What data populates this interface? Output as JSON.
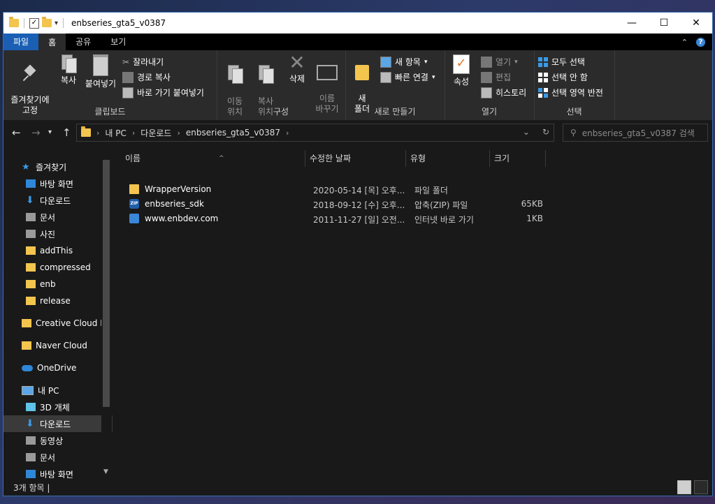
{
  "window": {
    "title": "enbseries_gta5_v0387",
    "controls": {
      "minimize": "—",
      "maximize": "☐",
      "close": "✕"
    }
  },
  "tabs": [
    {
      "label": "파일"
    },
    {
      "label": "홈"
    },
    {
      "label": "공유"
    },
    {
      "label": "보기"
    }
  ],
  "ribbon": {
    "clipboard": {
      "label": "클립보드",
      "pin": "즐겨찾기에\n고정",
      "copy": "복사",
      "paste": "붙여넣기",
      "cut": "잘라내기",
      "copy_path": "경로 복사",
      "paste_shortcut": "바로 가기 붙여넣기"
    },
    "organize": {
      "label": "구성",
      "move": "이동\n위치",
      "copy_to": "복사\n위치",
      "delete": "삭제",
      "rename": "이름\n바꾸기"
    },
    "new": {
      "label": "새로 만들기",
      "new_folder": "새\n폴더",
      "new_item": "새 항목",
      "easy_access": "빠른 연결"
    },
    "open": {
      "label": "열기",
      "properties": "속성",
      "open": "열기",
      "edit": "편집",
      "history": "히스토리"
    },
    "select": {
      "label": "선택",
      "select_all": "모두 선택",
      "select_none": "선택 안 함",
      "invert": "선택 영역 반전"
    }
  },
  "address": {
    "crumbs": [
      "내 PC",
      "다운로드",
      "enbseries_gta5_v0387"
    ],
    "search_placeholder": "enbseries_gta5_v0387 검색"
  },
  "nav": {
    "quick_access": "즐겨찾기",
    "items": [
      {
        "label": "바탕 화면"
      },
      {
        "label": "다운로드"
      },
      {
        "label": "문서"
      },
      {
        "label": "사진"
      },
      {
        "label": "addThis"
      },
      {
        "label": "compressed"
      },
      {
        "label": "enb"
      },
      {
        "label": "release"
      }
    ],
    "creative_cloud": "Creative Cloud Fil",
    "naver_cloud": "Naver Cloud",
    "onedrive": "OneDrive",
    "this_pc": "내 PC",
    "pc_items": [
      {
        "label": "3D 개체"
      },
      {
        "label": "다운로드"
      },
      {
        "label": "동영상"
      },
      {
        "label": "문서"
      },
      {
        "label": "바탕 화면"
      }
    ]
  },
  "columns": {
    "name": "이름",
    "date": "수정한 날짜",
    "type": "유형",
    "size": "크기"
  },
  "files": [
    {
      "name": "WrapperVersion",
      "date": "2020-05-14 [목] 오후...",
      "type": "파일 폴더",
      "size": "",
      "icon": "folder-icon"
    },
    {
      "name": "enbseries_sdk",
      "date": "2018-09-12 [수] 오후...",
      "type": "압축(ZIP) 파일",
      "size": "65KB",
      "icon": "zip-icon"
    },
    {
      "name": "www.enbdev.com",
      "date": "2011-11-27 [일] 오전...",
      "type": "인터넷 바로 가기",
      "size": "1KB",
      "icon": "internet-shortcut-icon"
    }
  ],
  "status": {
    "count": "3개 항목"
  },
  "colors": {
    "accent": "#1a5fb4",
    "background": "#191919",
    "ribbon": "#2b2b2b"
  }
}
